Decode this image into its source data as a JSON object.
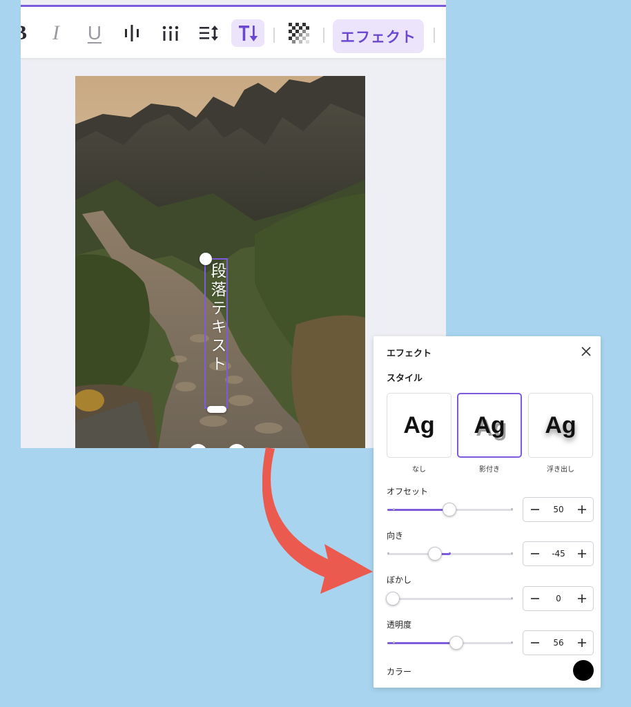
{
  "toolbar": {
    "bold_label": "B",
    "italic_label": "I",
    "underline_label": "U",
    "effect_label": "エフェクト"
  },
  "canvas": {
    "paragraph_text": "段落テキスト"
  },
  "effects_panel": {
    "title": "エフェクト",
    "style_heading": "スタイル",
    "styles": [
      {
        "sample": "Ag",
        "caption": "なし"
      },
      {
        "sample": "Ag",
        "caption": "影付き"
      },
      {
        "sample": "Ag",
        "caption": "浮き出し"
      }
    ],
    "selected_style": "影付き",
    "controls": [
      {
        "label": "オフセット",
        "value": "50"
      },
      {
        "label": "向き",
        "value": "-45"
      },
      {
        "label": "ぼかし",
        "value": "0"
      },
      {
        "label": "透明度",
        "value": "56"
      }
    ],
    "color_label": "カラー",
    "color_value": "#000000"
  },
  "colors": {
    "accent": "#7d5bdc",
    "background": "#a8d4f0",
    "arrow": "#ea5a4f"
  }
}
